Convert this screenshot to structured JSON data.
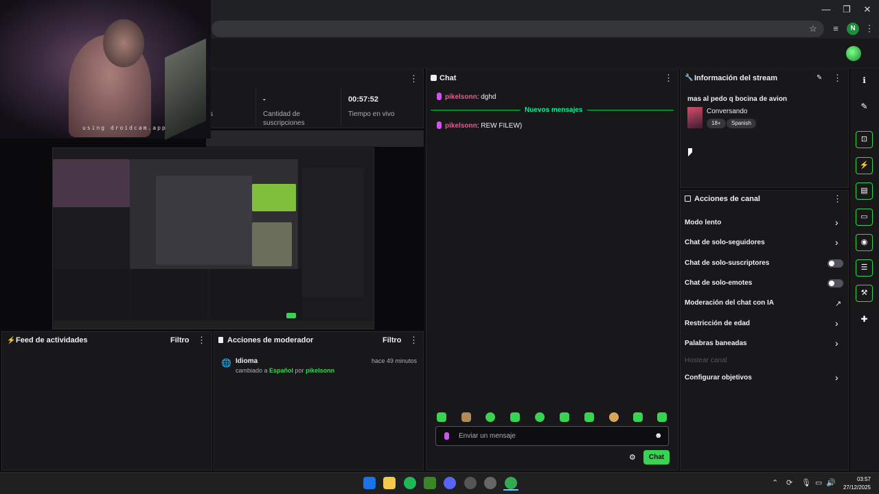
{
  "window": {
    "minimize": "—",
    "restore": "❐",
    "close": "✕"
  },
  "browser": {
    "bookmark_icon": "☆",
    "cast_icon": "≡",
    "profile_initial": "N",
    "menu_icon": "⋮"
  },
  "webcam": {
    "overlay_text": "using droidcam.app"
  },
  "stats": {
    "subs_value": "-",
    "subs_label": "Cantidad de suscripciones",
    "live_value": "00:57:52",
    "live_label": "Tiempo en vivo",
    "partial_label": "s"
  },
  "chat": {
    "title": "Chat",
    "messages": [
      {
        "user": "pikelsonn",
        "text": ": dghd"
      },
      {
        "user": "pikelsonn",
        "text": ": REW FILEW)"
      }
    ],
    "new_messages_label": "Nuevos mensajes",
    "input_placeholder": "Enviar un mensaje",
    "send_label": "Chat"
  },
  "stream_info": {
    "title": "Información del stream",
    "stream_title": "mas al pedo q bocina de avion",
    "category": "Conversando",
    "tags": [
      "18+",
      "Spanish"
    ]
  },
  "channel_actions": {
    "title": "Acciones de canal",
    "items": [
      {
        "label": "Modo lento",
        "kind": "chevron"
      },
      {
        "label": "Chat de solo-seguidores",
        "kind": "chevron"
      },
      {
        "label": "Chat de solo-suscriptores",
        "kind": "toggle"
      },
      {
        "label": "Chat de solo-emotes",
        "kind": "toggle"
      },
      {
        "label": "Moderación del chat con IA",
        "kind": "external"
      },
      {
        "label": "Restricción de edad",
        "kind": "chevron"
      },
      {
        "label": "Palabras baneadas",
        "kind": "chevron"
      },
      {
        "label": "Hostear canal",
        "kind": "disabled"
      },
      {
        "label": "Configurar objetivos",
        "kind": "chevron"
      }
    ]
  },
  "activity_feed": {
    "title": "Feed de actividades",
    "filter_label": "Filtro"
  },
  "mod_actions": {
    "title": "Acciones de moderador",
    "filter_label": "Filtro",
    "entry": {
      "heading": "Idioma",
      "time": "hace 49 minutos",
      "prefix": "cambiado a ",
      "value": "Español",
      "middle": " por ",
      "user": "pikelsonn"
    }
  },
  "taskbar": {
    "time": "03:57",
    "date": "27/12/2025"
  },
  "colors": {
    "accent": "#39d353",
    "username": "#ff4f8b",
    "new_messages": "#00f593",
    "background": "#0e0e10",
    "panel": "#18181b"
  }
}
